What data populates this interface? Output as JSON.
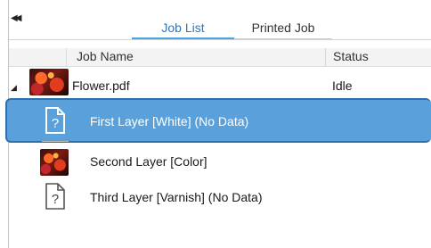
{
  "tabs": [
    {
      "label": "Job List",
      "active": true
    },
    {
      "label": "Printed Job",
      "active": false
    }
  ],
  "columns": {
    "job_name": "Job Name",
    "status": "Status"
  },
  "job": {
    "name": "Flower.pdf",
    "status": "Idle",
    "icon": "flower-thumbnail"
  },
  "layers": [
    {
      "label": "First Layer [White]  (No Data)",
      "icon": "no-data-document-icon",
      "selected": true
    },
    {
      "label": "Second Layer [Color]",
      "icon": "flower-thumbnail",
      "selected": false
    },
    {
      "label": "Third Layer [Varnish]  (No Data)",
      "icon": "no-data-document-icon",
      "selected": false
    }
  ],
  "colors": {
    "accent": "#2b78c6",
    "selection": "#5aa1dc",
    "selection_border": "#2f6fab"
  },
  "icons": {
    "collapse": "double-left-arrow-icon",
    "expand": "triangle-down-icon"
  }
}
